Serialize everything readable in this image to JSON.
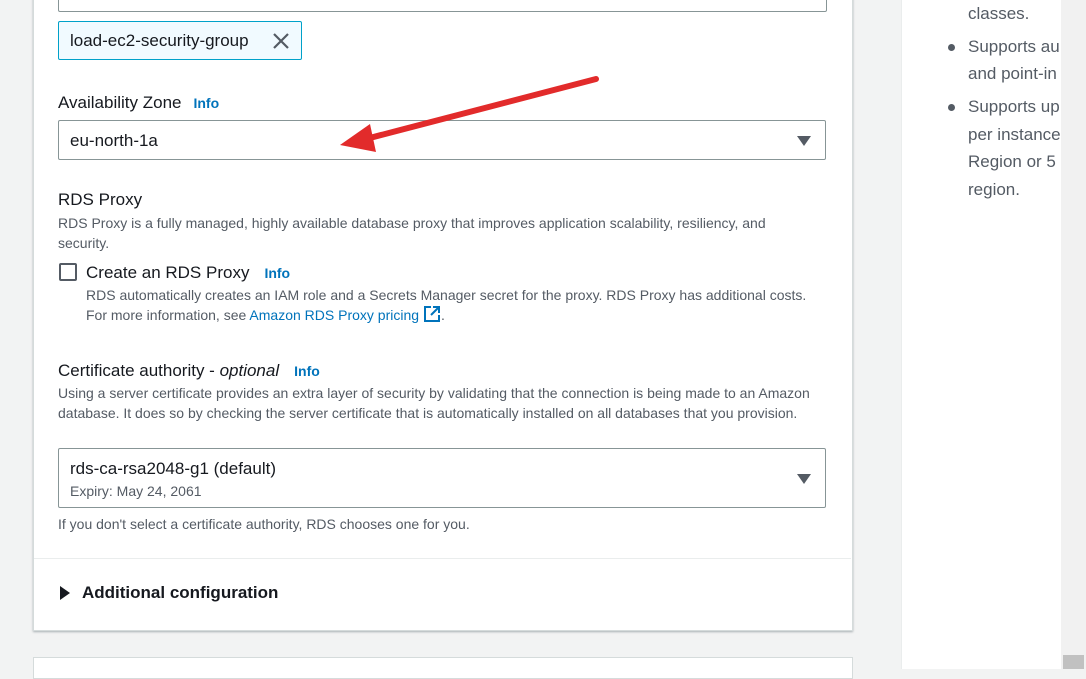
{
  "security_group": {
    "token_label": "load-ec2-security-group"
  },
  "availability_zone": {
    "label": "Availability Zone",
    "info": "Info",
    "value": "eu-north-1a"
  },
  "rds_proxy": {
    "heading": "RDS Proxy",
    "description": "RDS Proxy is a fully managed, highly available database proxy that improves application scalability, resiliency, and security.",
    "checkbox_label": "Create an RDS Proxy",
    "info": "Info",
    "checked": false,
    "help_text": "RDS automatically creates an IAM role and a Secrets Manager secret for the proxy. RDS Proxy has additional costs. For more information, see",
    "link_text": "Amazon RDS Proxy pricing",
    "period": "."
  },
  "certificate_authority": {
    "label": "Certificate authority - ",
    "optional": "optional",
    "info": "Info",
    "description": "Using a server certificate provides an extra layer of security by validating that the connection is being made to an Amazon database. It does so by checking the server certificate that is automatically installed on all databases that you provision.",
    "value": "rds-ca-rsa2048-g1 (default)",
    "expiry": "Expiry: May 24, 2061",
    "hint": "If you don't select a certificate authority, RDS chooses one for you."
  },
  "additional_configuration": {
    "label": "Additional configuration"
  },
  "side_panel": {
    "lines": [
      "classes.",
      "Supports au",
      "and point-in",
      "Supports up",
      "per instance",
      "Region or 5",
      "region."
    ]
  },
  "colors": {
    "link": "#0073bb",
    "annotation_arrow": "#e22b2b",
    "token_border": "#00a1c9"
  },
  "icons": {
    "token_remove": "close-icon",
    "select_caret": "caret-down-icon",
    "external_link": "external-link-icon",
    "expander": "caret-right-icon"
  }
}
